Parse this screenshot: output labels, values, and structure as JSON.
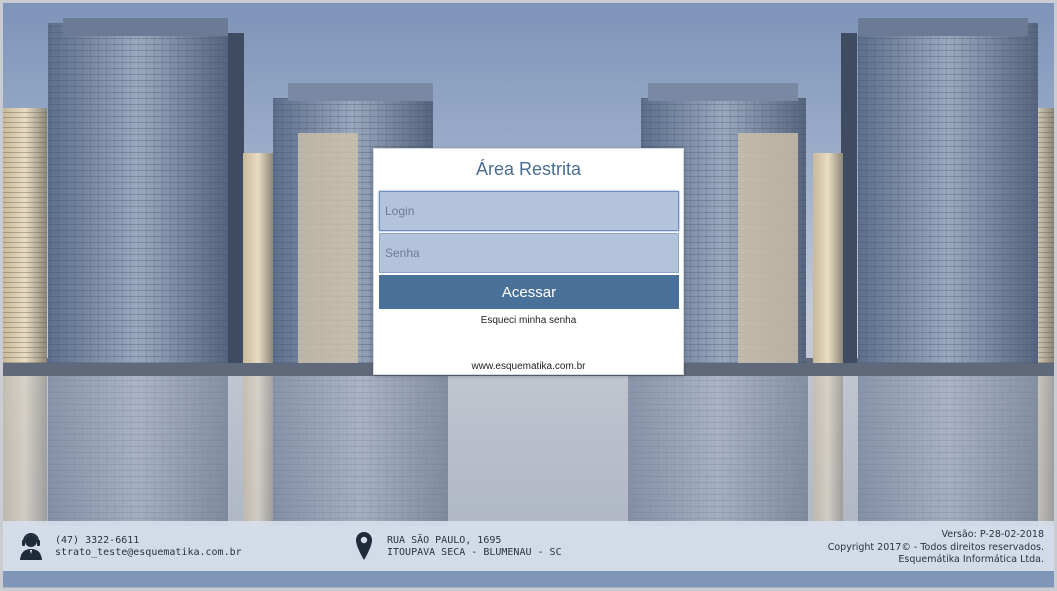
{
  "login": {
    "title": "Área Restrita",
    "login_placeholder": "Login",
    "senha_placeholder": "Senha",
    "submit_label": "Acessar",
    "forgot_label": "Esqueci minha senha",
    "website": "www.esquematika.com.br"
  },
  "footer": {
    "phone": "(47) 3322-6611",
    "email": "strato_teste@esquematika.com.br",
    "address_line1": "RUA SÃO PAULO, 1695",
    "address_line2": "ITOUPAVA SECA - BLUMENAU - SC",
    "version": "Versão: P-28-02-2018",
    "copyright": "Copyright 2017© - Todos direitos reservados.",
    "company": "Esquemátika Informática Ltda.",
    "contact_icon": "user-headset-icon",
    "location_icon": "map-pin-icon"
  },
  "colors": {
    "accent": "#4a7199",
    "title": "#4a6d93",
    "field_bg": "#b3c3db"
  }
}
